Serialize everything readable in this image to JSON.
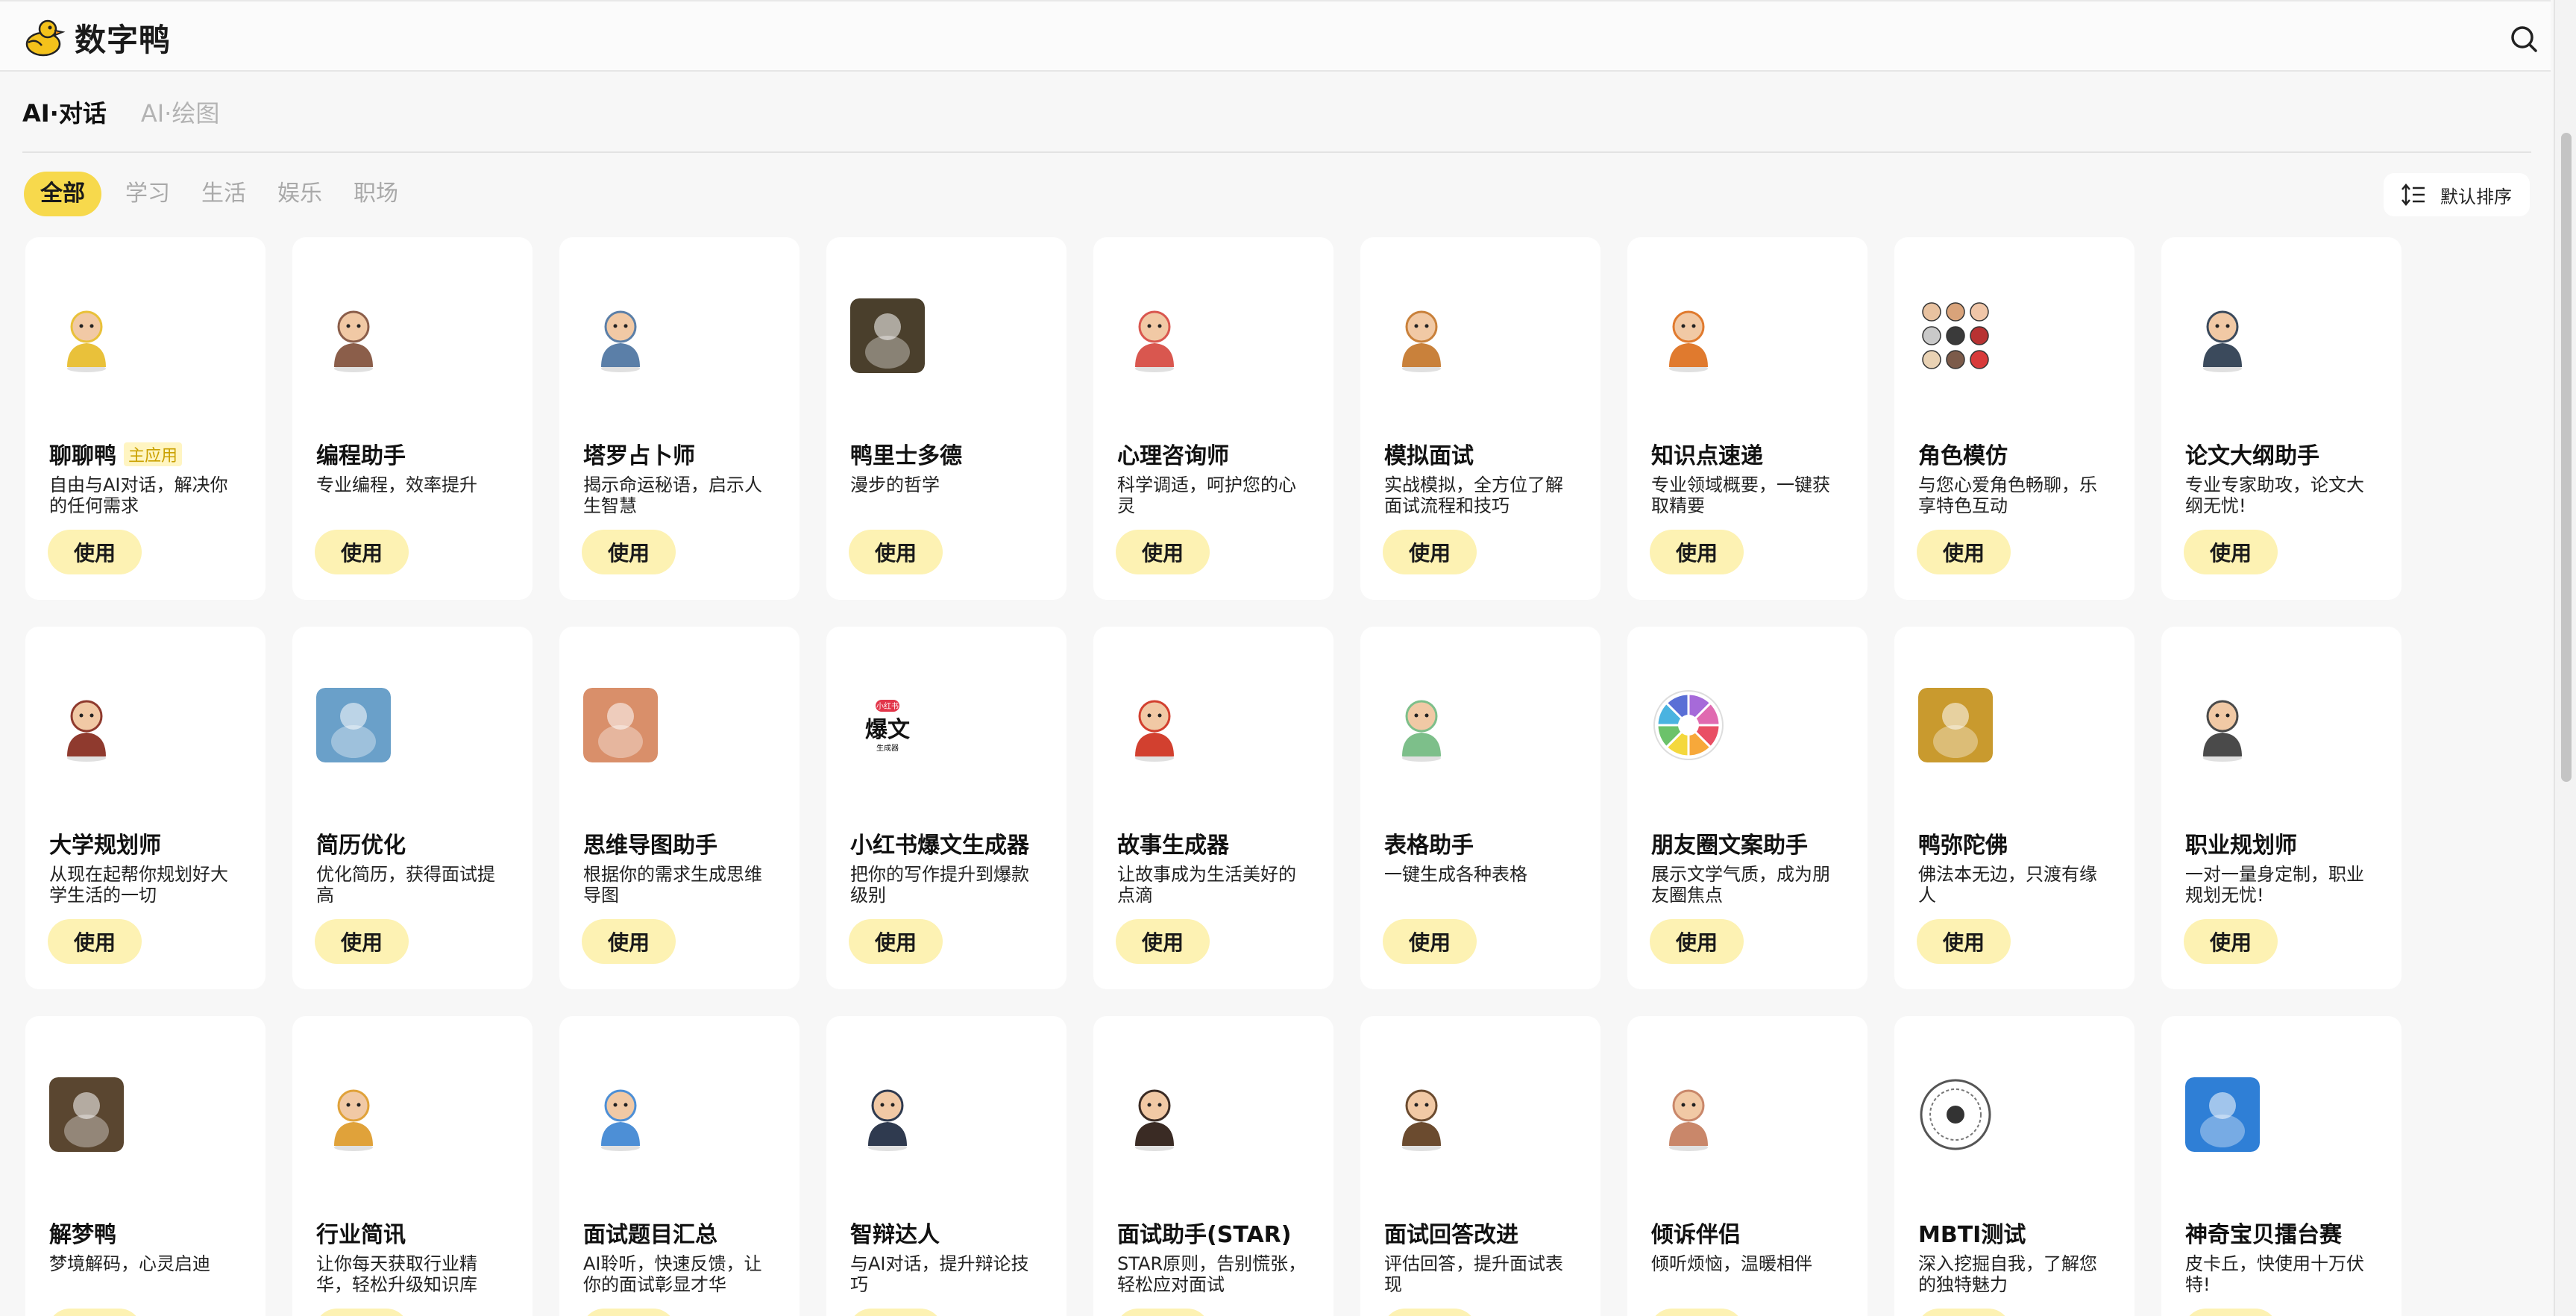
{
  "header": {
    "brand_name": "数字鸭"
  },
  "main_tabs": [
    {
      "label": "AI·对话",
      "active": true
    },
    {
      "label": "AI·绘图",
      "active": false
    }
  ],
  "categories": [
    {
      "label": "全部",
      "active": true
    },
    {
      "label": "学习",
      "active": false
    },
    {
      "label": "生活",
      "active": false
    },
    {
      "label": "娱乐",
      "active": false
    },
    {
      "label": "职场",
      "active": false
    }
  ],
  "sort": {
    "label": "默认排序"
  },
  "use_label": "使用",
  "cards": [
    {
      "title": "聊聊鸭",
      "badge": "主应用",
      "desc": "自由与AI对话，解决你的任何需求",
      "icon": "duck-detective-avatar",
      "color": "#e9c13a"
    },
    {
      "title": "编程助手",
      "desc": "专业编程，效率提升",
      "icon": "programmer-avatar",
      "color": "#8b5e4a"
    },
    {
      "title": "塔罗占卜师",
      "desc": "揭示命运秘语，启示人生智慧",
      "icon": "tarot-reader-avatar",
      "color": "#5b7fa8"
    },
    {
      "title": "鸭里士多德",
      "desc": "漫步的哲学",
      "icon": "philosopher-duck-avatar",
      "color": "#4a3f2c"
    },
    {
      "title": "心理咨询师",
      "desc": "科学调适，呵护您的心灵",
      "icon": "counselor-avatar",
      "color": "#d9574f"
    },
    {
      "title": "模拟面试",
      "desc": "实战模拟，全方位了解面试流程和技巧",
      "icon": "interview-avatar",
      "color": "#c9813b"
    },
    {
      "title": "知识点速递",
      "desc": "专业领域概要，一键获取精要",
      "icon": "gift-book-avatar",
      "color": "#e07a2e"
    },
    {
      "title": "角色模仿",
      "desc": "与您心爱角色畅聊，乐享特色互动",
      "icon": "role-grid-avatar",
      "color": "#7d6e64"
    },
    {
      "title": "论文大纲助手",
      "desc": "专业专家助攻，论文大纲无忧!",
      "icon": "professor-avatar",
      "color": "#3b4a5c"
    },
    {
      "title": "大学规划师",
      "desc": "从现在起帮你规划好大学生活的一切",
      "icon": "graduate-avatar",
      "color": "#8f3a2e"
    },
    {
      "title": "简历优化",
      "desc": "优化简历，获得面试提高",
      "icon": "resume-avatar",
      "color": "#6aa0c9"
    },
    {
      "title": "思维导图助手",
      "desc": "根据你的需求生成思维导图",
      "icon": "mind-tree-avatar",
      "color": "#d98f6a"
    },
    {
      "title": "小红书爆文生成器",
      "desc": "把你的写作提升到爆款级别",
      "icon": "xiaohongshu-avatar",
      "color": "#e2364a",
      "icon_text_top": "小红书",
      "icon_text_main": "爆文",
      "icon_text_sub": "生成器"
    },
    {
      "title": "故事生成器",
      "desc": "让故事成为生活美好的点滴",
      "icon": "magic-hat-avatar",
      "color": "#d2402f"
    },
    {
      "title": "表格助手",
      "desc": "一键生成各种表格",
      "icon": "plant-avatar",
      "color": "#7dbf8a"
    },
    {
      "title": "朋友圈文案助手",
      "desc": "展示文学气质，成为朋友圈焦点",
      "icon": "color-wheel-avatar",
      "color": "#a66ad9"
    },
    {
      "title": "鸭弥陀佛",
      "desc": "佛法本无边，只渡有缘人",
      "icon": "golden-buddha-avatar",
      "color": "#c99a2e"
    },
    {
      "title": "职业规划师",
      "desc": "一对一量身定制，职业规划无忧!",
      "icon": "career-avatar",
      "color": "#4a4a4a"
    },
    {
      "title": "解梦鸭",
      "desc": "梦境解码，心灵启迪",
      "icon": "dream-duck-avatar",
      "color": "#5a4630"
    },
    {
      "title": "行业简讯",
      "desc": "让你每天获取行业精华，轻松升级知识库",
      "icon": "news-avatar",
      "color": "#e0a23a"
    },
    {
      "title": "面试题目汇总",
      "desc": "AI聆听，快速反馈，让你的面试彰显才华",
      "icon": "notepad-avatar",
      "color": "#4d8fd6"
    },
    {
      "title": "智辩达人",
      "desc": "与AI对话，提升辩论技巧",
      "icon": "robot-avatar",
      "color": "#2f3a4f"
    },
    {
      "title": "面试助手(STAR)",
      "desc": "STAR原则，告别慌张，轻松应对面试",
      "icon": "woman-avatar",
      "color": "#3a2b24"
    },
    {
      "title": "面试回答改进",
      "desc": "评估回答，提升面试表现",
      "icon": "meeting-avatar",
      "color": "#6b4b2f"
    },
    {
      "title": "倾诉伴侣",
      "desc": "倾听烦恼，温暖相伴",
      "icon": "couple-avatar",
      "color": "#c9876a"
    },
    {
      "title": "MBTI测试",
      "desc": "深入挖掘自我，了解您的独特魅力",
      "icon": "mbti-dial-avatar",
      "color": "#555555"
    },
    {
      "title": "神奇宝贝擂台赛",
      "desc": "皮卡丘，快使用十万伏特!",
      "icon": "pokemon-avatar",
      "color": "#2f7fd6"
    }
  ]
}
